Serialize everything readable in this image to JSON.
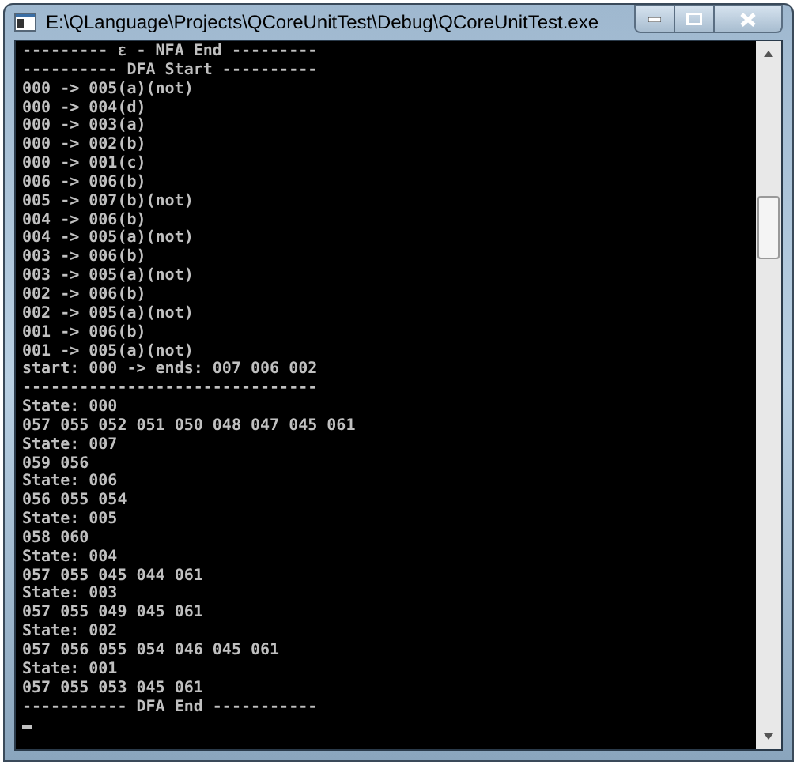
{
  "window": {
    "title": "E:\\QLanguage\\Projects\\QCoreUnitTest\\Debug\\QCoreUnitTest.exe"
  },
  "console": {
    "lines": [
      "--------- ε - NFA End ---------",
      "---------- DFA Start ----------",
      "000 -> 005(a)(not)",
      "000 -> 004(d)",
      "000 -> 003(a)",
      "000 -> 002(b)",
      "000 -> 001(c)",
      "006 -> 006(b)",
      "005 -> 007(b)(not)",
      "004 -> 006(b)",
      "004 -> 005(a)(not)",
      "003 -> 006(b)",
      "003 -> 005(a)(not)",
      "002 -> 006(b)",
      "002 -> 005(a)(not)",
      "001 -> 006(b)",
      "001 -> 005(a)(not)",
      "start: 000 -> ends: 007 006 002",
      "-------------------------------",
      "State: 000",
      "057 055 052 051 050 048 047 045 061",
      "State: 007",
      "059 056",
      "State: 006",
      "056 055 054",
      "State: 005",
      "058 060",
      "State: 004",
      "057 055 045 044 061",
      "State: 003",
      "057 055 049 045 061",
      "State: 002",
      "057 056 055 054 046 045 061",
      "State: 001",
      "057 055 053 045 061",
      "----------- DFA End -----------"
    ]
  }
}
